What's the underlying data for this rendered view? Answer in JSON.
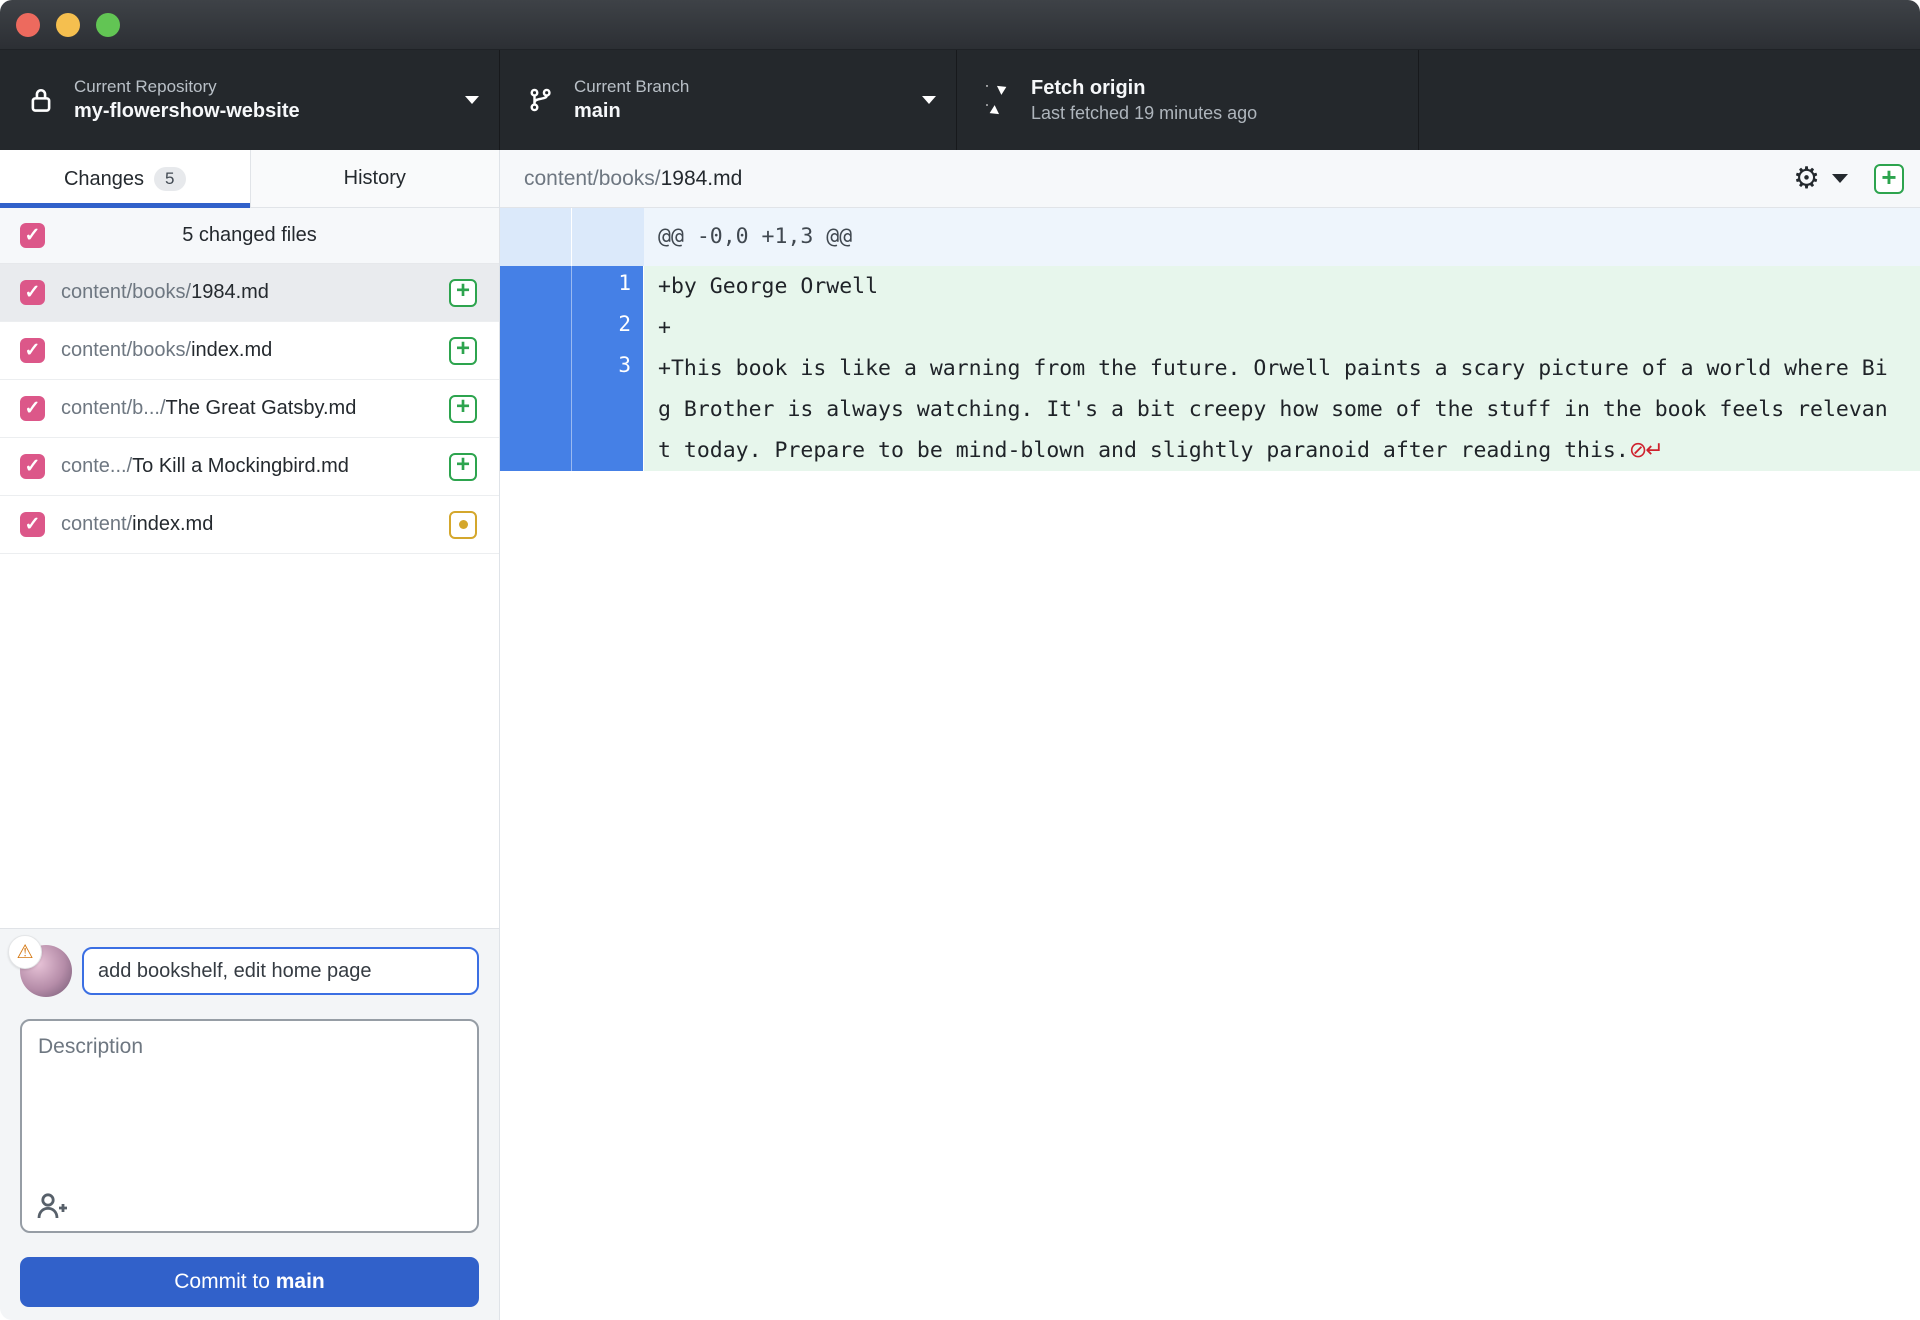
{
  "toolbar": {
    "repository": {
      "label": "Current Repository",
      "value": "my-flowershow-website"
    },
    "branch": {
      "label": "Current Branch",
      "value": "main"
    },
    "fetch": {
      "title": "Fetch origin",
      "subtitle": "Last fetched 19 minutes ago"
    }
  },
  "tabs": {
    "changes_label": "Changes",
    "changes_count": "5",
    "history_label": "History"
  },
  "file_list": {
    "header": "5 changed files",
    "files": [
      {
        "dir": "content/books/",
        "name": "1984.md",
        "status": "added",
        "icon": "+"
      },
      {
        "dir": "content/books/",
        "name": "index.md",
        "status": "added",
        "icon": "+"
      },
      {
        "dir": "content/b.../",
        "name": "The Great Gatsby.md",
        "status": "added",
        "icon": "+"
      },
      {
        "dir": "conte.../",
        "name": "To Kill a Mockingbird.md",
        "status": "added",
        "icon": "+"
      },
      {
        "dir": "content/",
        "name": "index.md",
        "status": "modified",
        "icon": ""
      }
    ]
  },
  "commit": {
    "summary_value": "add bookshelf, edit home page",
    "description_placeholder": "Description",
    "button_prefix": "Commit to ",
    "button_branch": "main"
  },
  "diff": {
    "file_dir": "content/books/",
    "file_name": "1984.md",
    "hunk_header": "@@ -0,0 +1,3 @@",
    "no_newline_marker": "⊘↵",
    "lines": [
      {
        "number": "1",
        "text": "+by George Orwell"
      },
      {
        "number": "2",
        "text": "+"
      },
      {
        "number": "3",
        "text": "+This book is like a warning from the future. Orwell paints a scary picture of a world where Big Brother is always watching. It's a bit creepy how some of the stuff in the book feels relevant today. Prepare to be mind-blown and slightly paranoid after reading this."
      }
    ]
  },
  "icons": {
    "check": "✓",
    "warning": "⚠",
    "gear": "⚙"
  },
  "colors": {
    "accent_blue": "#3161ca",
    "checkbox_pink": "#dc5789",
    "added_green": "#2da44e",
    "modified_yellow": "#d4a72c",
    "no_newline_red": "#cf222e",
    "gutter_blue": "#4580e6",
    "added_bg": "#e7f6ec"
  }
}
